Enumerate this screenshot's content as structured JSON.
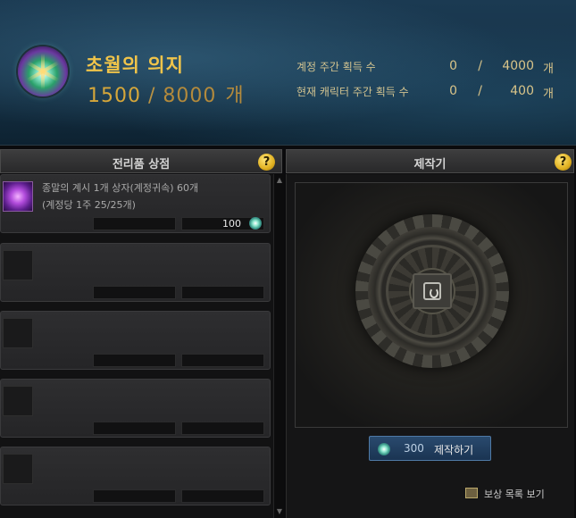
{
  "header": {
    "title": "초월의 의지",
    "current": "1500",
    "separator": "/",
    "max": "8000",
    "unit": "개",
    "stats": [
      {
        "label": "계정 주간 획득 수",
        "current": "0",
        "separator": "/",
        "max": "4000",
        "unit": "개"
      },
      {
        "label": "현재 캐릭터 주간 획득 수",
        "current": "0",
        "separator": "/",
        "max": "400",
        "unit": "개"
      }
    ]
  },
  "shop": {
    "title": "전리품 상점",
    "help": "?",
    "items": [
      {
        "name": "종말의 계시 1개 상자(계정귀속) 60개",
        "sub": "(계정당 1주 25/25개)",
        "price": "100",
        "icon": "purple-box-icon"
      },
      {
        "name": "",
        "sub": "",
        "price": ""
      },
      {
        "name": "",
        "sub": "",
        "price": ""
      },
      {
        "name": "",
        "sub": "",
        "price": ""
      },
      {
        "name": "",
        "sub": "",
        "price": ""
      }
    ]
  },
  "crafting": {
    "title": "제작기",
    "help": "?",
    "button": {
      "cost": "300",
      "label": "제작하기"
    },
    "reward_link": "보상 목록 보기"
  },
  "colors": {
    "gold": "#f0c44a",
    "button_blue": "#2a4a6e",
    "panel_dark": "#252527"
  }
}
